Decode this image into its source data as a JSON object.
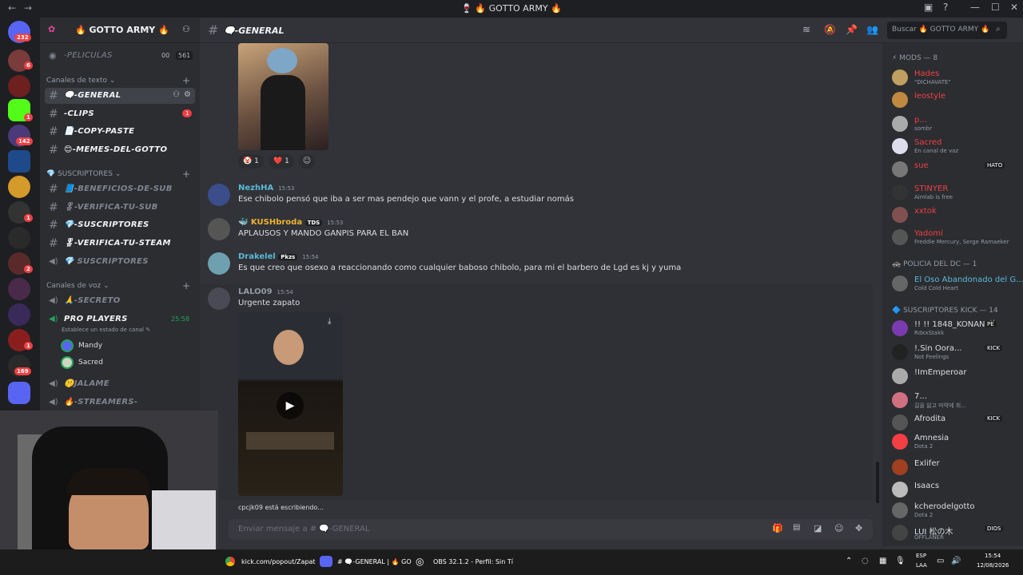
{
  "window": {
    "title": "🍷 🔥 GOTTO ARMY 🔥"
  },
  "server": {
    "name": "🔥 GOTTO ARMY 🔥",
    "badges": [
      "232",
      "6",
      "1",
      "142",
      "1",
      "2",
      "1",
      "169"
    ],
    "pinned_channel": {
      "name": "-PELICULAS",
      "count_a": "00",
      "count_b": "561"
    },
    "categories": {
      "text": "Canales de texto",
      "subs": "SUSCRIPTORES",
      "voice": "Canales de voz"
    },
    "text_channels": [
      {
        "name": "🗨️-GENERAL",
        "badge": ""
      },
      {
        "name": "-CLIPS",
        "badge": "1"
      },
      {
        "name": "📄-COPY-PASTE",
        "badge": ""
      },
      {
        "name": "😊-MEMES-DEL-GOTTO",
        "badge": ""
      }
    ],
    "sub_channels": [
      "📘-BENEFICIOS-DE-SUB",
      "🎖-VERIFICA-TU-SUB",
      "💎-SUSCRIPTORES",
      "🎖-VERIFICA-TU-STEAM",
      "💎 SUSCRIPTORES"
    ],
    "voice_channels": [
      {
        "name": "🙏-SECRETO"
      },
      {
        "name": "PRO PLAYERS",
        "timer": "25:58",
        "status": "Establece un estado de canal ✎",
        "users": [
          "Mandy",
          "Sacred"
        ]
      },
      {
        "name": "🤫JALAME"
      },
      {
        "name": "🔥-STREAMERS-"
      }
    ]
  },
  "channel": {
    "name": "🗨️-GENERAL",
    "typing": "cpcjk09 está escribiendo...",
    "placeholder": "Enviar mensaje a # 🗨️-GENERAL"
  },
  "reactions": [
    {
      "emoji": "🤡",
      "count": "1"
    },
    {
      "emoji": "❤️",
      "count": "1"
    }
  ],
  "messages": [
    {
      "user": "NezhHA",
      "color": "#5cb8d6",
      "time": "15:53",
      "text": "Ese chibolo pensó que iba a ser mas pendejo que vann y el profe, a estudiar nomás"
    },
    {
      "user": "🐳 KUSHbroda",
      "color": "#f0b232",
      "time": "15:53",
      "tag": "TDS",
      "text": "APLAUSOS Y MANDO GANPIS PARA EL BAN"
    },
    {
      "user": "Drakelel",
      "color": "#5cb8d6",
      "time": "15:54",
      "tag": "Pkzs",
      "text": "Es que creo que osexo a reaccionando como cualquier baboso chibolo, para mi el barbero de Lgd es kj y yuma"
    },
    {
      "user": "LALO09",
      "color": "#949ba4",
      "time": "15:54",
      "text": "Urgente zapato"
    }
  ],
  "members": {
    "mods_header": "MODS — 8",
    "mods": [
      {
        "name": "Hades",
        "status": "\"DICHAVATE\"",
        "color": "#f23f43"
      },
      {
        "name": "leostyle",
        "status": "",
        "color": "#f23f43"
      },
      {
        "name": "p...",
        "status": "sombr",
        "color": "#f23f43"
      },
      {
        "name": "Sacred",
        "status": "En canal de voz",
        "color": "#f23f43"
      },
      {
        "name": "sue",
        "status": "",
        "color": "#f23f43",
        "tag": "HATO"
      },
      {
        "name": "STINYER",
        "status": "Aimlab is free",
        "color": "#f23f43"
      },
      {
        "name": "xxtok",
        "status": "",
        "color": "#f23f43"
      },
      {
        "name": "Yadomi",
        "status": "Freddie Mercury, Serge Ramaeker",
        "color": "#f23f43"
      }
    ],
    "police_header": "POLICIA DEL DC — 1",
    "police": [
      {
        "name": "El Oso Abandonado del G...",
        "status": "Cold Cold Heart",
        "color": "#5cb8d6"
      }
    ],
    "subs_header": "SUSCRIPTORES KICK — 14",
    "subs": [
      {
        "name": "!! !! 1848_KONAN ✨",
        "status": "RdxxStakk",
        "color": "#dbdee1",
        "tag": "PE"
      },
      {
        "name": "!.Sin Oora...",
        "status": "Not Feelings",
        "color": "#dbdee1",
        "tag": "KICK"
      },
      {
        "name": "!ImEmperoar",
        "status": "",
        "color": "#dbdee1"
      },
      {
        "name": "7...",
        "status": "길을 잃고 마약에 취...",
        "color": "#dbdee1"
      },
      {
        "name": "Afrodita",
        "status": "",
        "color": "#dbdee1",
        "tag": "KICK"
      },
      {
        "name": "Amnesia",
        "status": "Dota 2",
        "color": "#dbdee1"
      },
      {
        "name": "Exlifer",
        "status": "",
        "color": "#dbdee1"
      },
      {
        "name": "Isaacs",
        "status": "",
        "color": "#dbdee1"
      },
      {
        "name": "kcherodelgotto",
        "status": "Dota 2",
        "color": "#dbdee1"
      },
      {
        "name": "LUI 松の木",
        "status": "OFFLANER",
        "color": "#dbdee1",
        "tag": "DIOS"
      }
    ]
  },
  "search": {
    "placeholder": "Buscar 🔥 GOTTO ARMY 🔥"
  },
  "taskbar": {
    "items": [
      "kick.com/popout/Zapat",
      "# 🗨️-GENERAL | 🔥 GO",
      "OBS 32.1.2 - Perfil: Sin Tí"
    ],
    "lang": "ESP",
    "region": "LAA",
    "time": "15:54",
    "date": "12/08/2026"
  },
  "colors": {
    "accent": "#5865f2",
    "bg": "#313338",
    "sidebar": "#2b2d31",
    "rail": "#1e1f22"
  }
}
